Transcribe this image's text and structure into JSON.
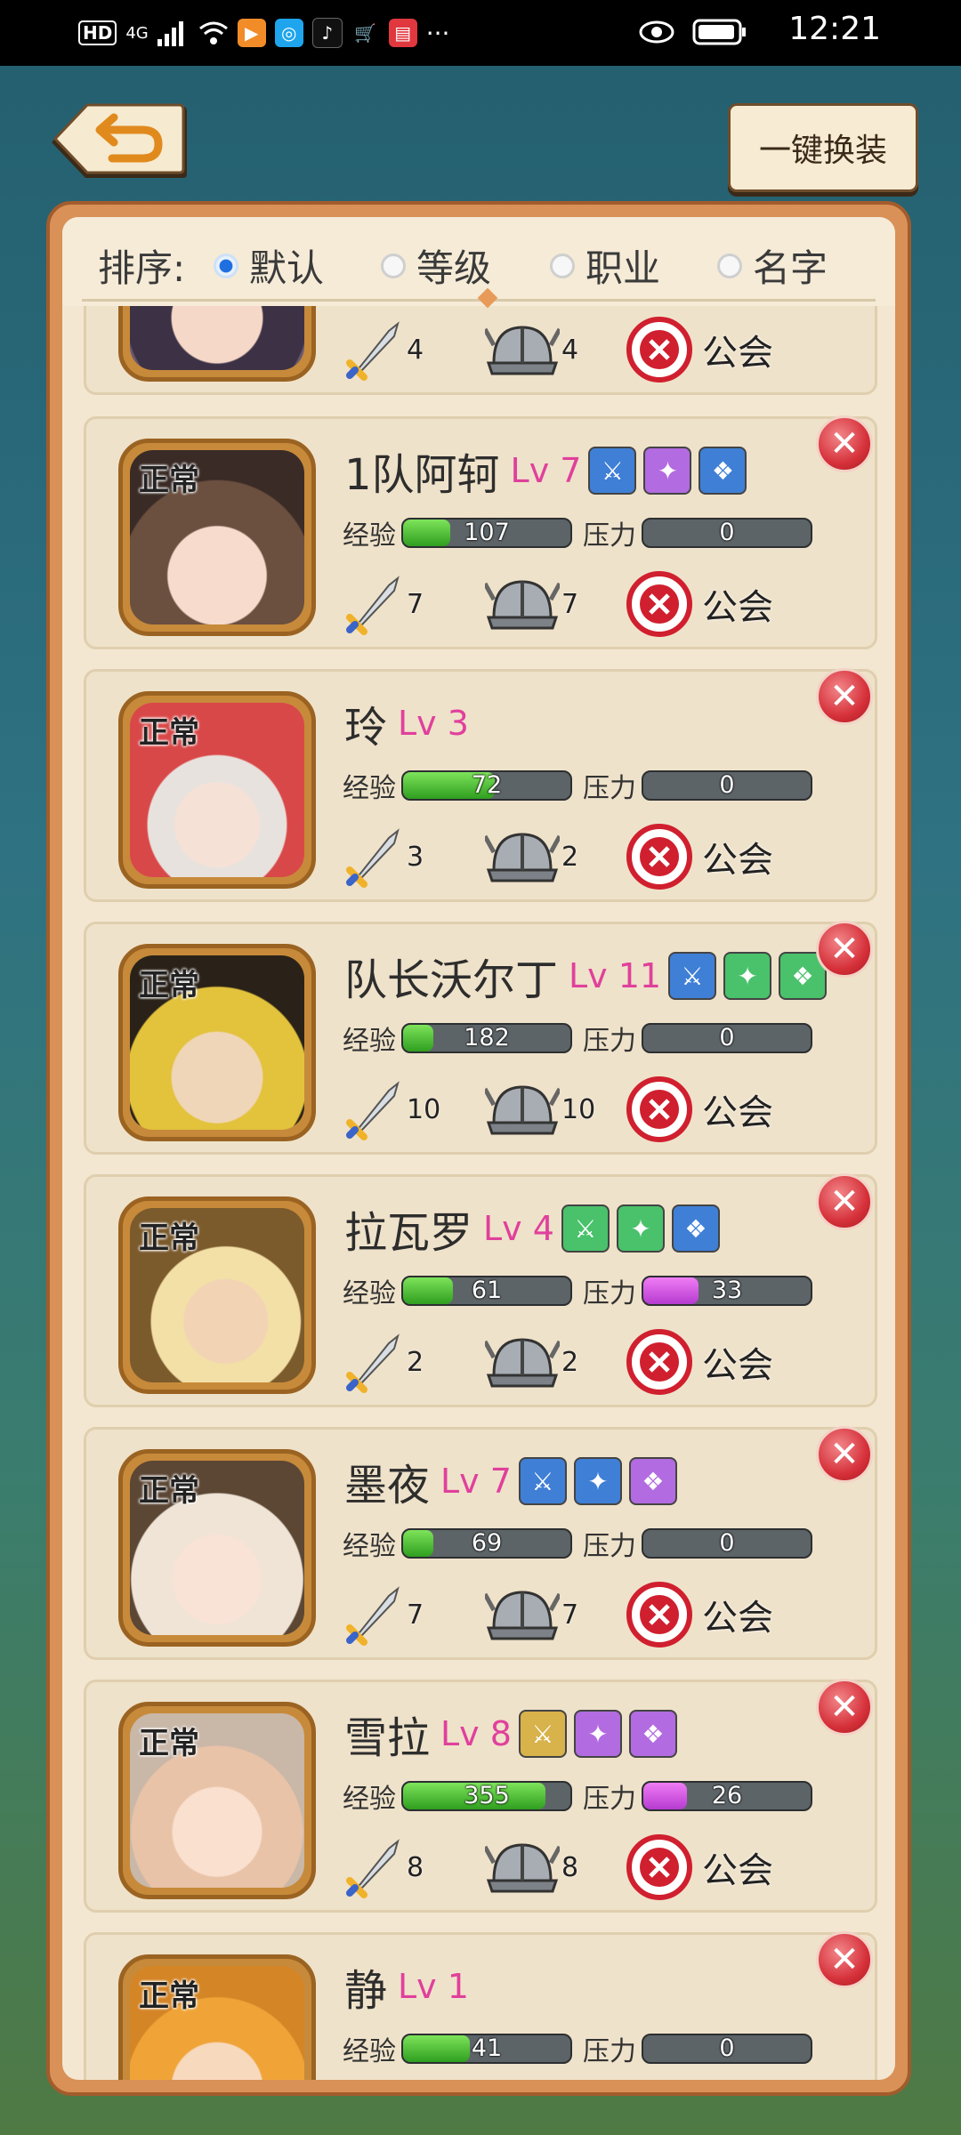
{
  "status_bar": {
    "left_badges": [
      "HD",
      "4G"
    ],
    "time": "12:21",
    "icons": [
      "signal-icon",
      "wifi-icon",
      "app-icon-orange",
      "app-icon-search",
      "tiktok-icon",
      "cart-icon",
      "book-icon",
      "more-icon",
      "eye-icon",
      "battery-icon"
    ]
  },
  "header": {
    "back_icon": "undo-arrow-icon",
    "swap_all_label": "一键换装"
  },
  "sort": {
    "label": "排序:",
    "options": [
      {
        "label": "默认",
        "selected": true
      },
      {
        "label": "等级",
        "selected": false
      },
      {
        "label": "职业",
        "selected": false
      },
      {
        "label": "名字",
        "selected": false
      }
    ]
  },
  "labels": {
    "exp": "经验",
    "stress": "压力",
    "guild": "公会",
    "status": "正常"
  },
  "heroes": [
    {
      "name": "",
      "level": "",
      "equip": [],
      "exp": "",
      "exp_pct": 0,
      "stress": "",
      "stress_pct": 0,
      "attack": "4",
      "defense": "4",
      "show_status": false,
      "show_close": false
    },
    {
      "name": "1队阿轲",
      "level": "Lv 7",
      "equip": [
        "blue",
        "purple",
        "blue"
      ],
      "exp": "107",
      "exp_pct": 0.28,
      "stress": "0",
      "stress_pct": 0,
      "attack": "7",
      "defense": "7",
      "show_status": true,
      "show_close": true
    },
    {
      "name": "玲",
      "level": "Lv 3",
      "equip": [],
      "exp": "72",
      "exp_pct": 0.55,
      "stress": "0",
      "stress_pct": 0,
      "attack": "3",
      "defense": "2",
      "show_status": true,
      "show_close": true
    },
    {
      "name": "队长沃尔丁",
      "level": "Lv 11",
      "equip": [
        "blue",
        "green",
        "green"
      ],
      "exp": "182",
      "exp_pct": 0.18,
      "stress": "0",
      "stress_pct": 0,
      "attack": "10",
      "defense": "10",
      "show_status": true,
      "show_close": true
    },
    {
      "name": "拉瓦罗",
      "level": "Lv 4",
      "equip": [
        "green",
        "green",
        "blue"
      ],
      "exp": "61",
      "exp_pct": 0.3,
      "stress": "33",
      "stress_pct": 0.33,
      "attack": "2",
      "defense": "2",
      "show_status": true,
      "show_close": true
    },
    {
      "name": "墨夜",
      "level": "Lv 7",
      "equip": [
        "blue",
        "blue",
        "purple"
      ],
      "exp": "69",
      "exp_pct": 0.18,
      "stress": "0",
      "stress_pct": 0,
      "attack": "7",
      "defense": "7",
      "show_status": true,
      "show_close": true
    },
    {
      "name": "雪拉",
      "level": "Lv 8",
      "equip": [
        "gold",
        "purple",
        "purple"
      ],
      "exp": "355",
      "exp_pct": 0.85,
      "stress": "26",
      "stress_pct": 0.26,
      "attack": "8",
      "defense": "8",
      "show_status": true,
      "show_close": true
    },
    {
      "name": "静",
      "level": "Lv 1",
      "equip": [],
      "exp": "41",
      "exp_pct": 0.4,
      "stress": "0",
      "stress_pct": 0,
      "attack": "",
      "defense": "",
      "show_status": true,
      "show_close": true
    }
  ],
  "colors": {
    "accent_level": "#e0409c",
    "close_red": "#d6313a",
    "exp_green": "#2f9e1f",
    "stress_purple": "#b53bd0"
  }
}
